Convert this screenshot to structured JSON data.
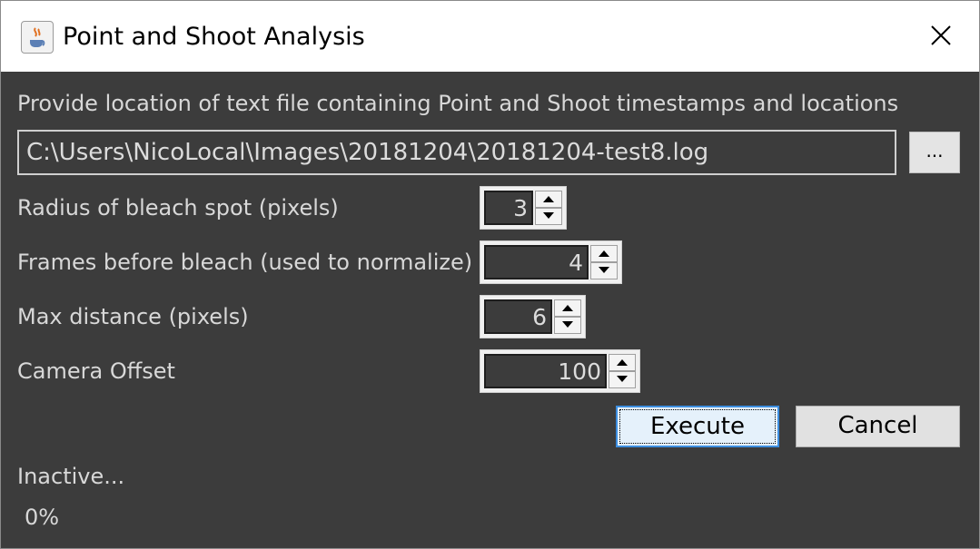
{
  "window": {
    "title": "Point and Shoot Analysis",
    "app_icon": "java-cup-icon",
    "close_icon": "close-icon"
  },
  "file": {
    "prompt": "Provide location of text file containing Point and Shoot  timestamps and locations",
    "path": "C:\\Users\\NicoLocal\\Images\\20181204\\20181204-test8.log",
    "browse_label": "..."
  },
  "params": {
    "radius_label": "Radius of bleach spot (pixels)",
    "radius_value": "3",
    "frames_label": "Frames before bleach (used to normalize)",
    "frames_value": "4",
    "maxdist_label": "Max distance (pixels)",
    "maxdist_value": "6",
    "offset_label": "Camera Offset",
    "offset_value": "100"
  },
  "actions": {
    "execute_label": "Execute",
    "cancel_label": "Cancel"
  },
  "status": {
    "text": "Inactive...",
    "progress_text": "0%",
    "progress": 0
  }
}
